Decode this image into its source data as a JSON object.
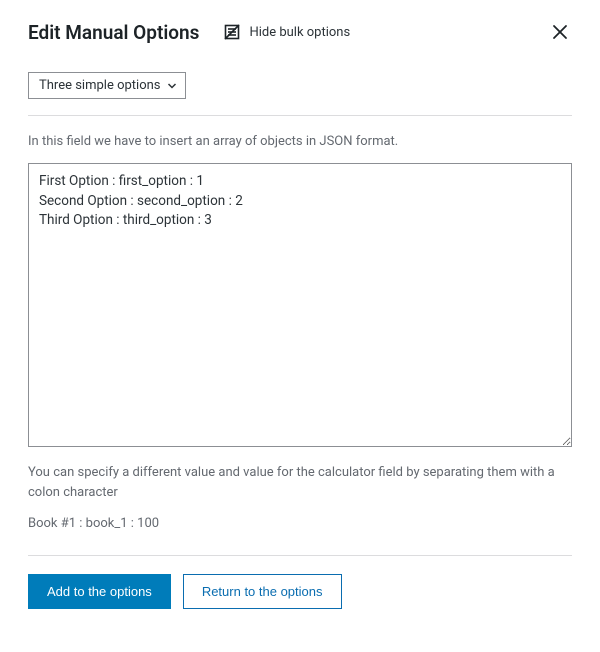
{
  "header": {
    "title": "Edit Manual Options",
    "hide_bulk_label": "Hide bulk options"
  },
  "dropdown": {
    "selected": "Three simple options"
  },
  "help": {
    "above_textarea": "In this field we have to insert an array of objects in JSON format.",
    "below_textarea": "You can specify a different value and value for the calculator field by separating them with a colon character",
    "example": "Book #1 : book_1 : 100"
  },
  "textarea": {
    "value": "First Option : first_option : 1\nSecond Option : second_option : 2\nThird Option : third_option : 3"
  },
  "footer": {
    "primary_label": "Add to the options",
    "secondary_label": "Return to the options"
  }
}
